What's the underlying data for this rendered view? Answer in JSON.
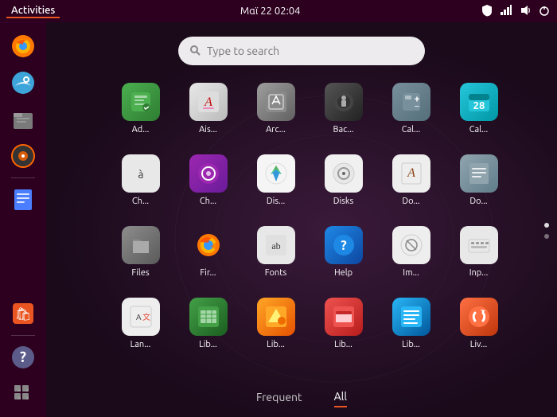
{
  "topbar": {
    "activities": "Activities",
    "datetime": "Μαϊ 22  02:04",
    "icons": [
      "shield",
      "network",
      "volume",
      "power"
    ]
  },
  "search": {
    "placeholder": "Type to search"
  },
  "apps": [
    {
      "label": "Ad...",
      "icon": "🔧",
      "color": "icon-green",
      "text": "Ad"
    },
    {
      "label": "Ais...",
      "icon": "🃏",
      "color": "icon-red",
      "text": "Ai"
    },
    {
      "label": "Arc...",
      "icon": "📦",
      "color": "icon-gray",
      "text": "Ar"
    },
    {
      "label": "Bac...",
      "icon": "💾",
      "color": "icon-dark",
      "text": "Ba"
    },
    {
      "label": "Cal...",
      "icon": "➕",
      "color": "icon-gray",
      "text": "Ca"
    },
    {
      "label": "Cal...",
      "icon": "28",
      "color": "icon-cyan",
      "text": "28"
    },
    {
      "label": "Ch...",
      "icon": "à",
      "color": "icon-white",
      "text": "Ch"
    },
    {
      "label": "Ch...",
      "icon": "◎",
      "color": "icon-purple",
      "text": "Ch"
    },
    {
      "label": "Dis...",
      "icon": "🥧",
      "color": "icon-white",
      "text": "Di"
    },
    {
      "label": "Disks",
      "icon": "💿",
      "color": "icon-white",
      "text": "Di"
    },
    {
      "label": "Do...",
      "icon": "A",
      "color": "icon-white",
      "text": "Do"
    },
    {
      "label": "Do...",
      "icon": "📖",
      "color": "icon-gray",
      "text": "Do"
    },
    {
      "label": "Files",
      "icon": "📁",
      "color": "icon-gray",
      "text": "Fi"
    },
    {
      "label": "Fir...",
      "icon": "🦊",
      "color": "icon-orange",
      "text": "Fi"
    },
    {
      "label": "Fonts",
      "icon": "ab",
      "color": "icon-white",
      "text": "Fo"
    },
    {
      "label": "Help",
      "icon": "?",
      "color": "icon-blue",
      "text": "He"
    },
    {
      "label": "Im...",
      "icon": "🔍",
      "color": "icon-white",
      "text": "Im"
    },
    {
      "label": "Inp...",
      "icon": "⌨",
      "color": "icon-white",
      "text": "In"
    },
    {
      "label": "Lan...",
      "icon": "A文",
      "color": "icon-white",
      "text": "La"
    },
    {
      "label": "Lib...",
      "icon": "📊",
      "color": "icon-deepgreen",
      "text": "Li"
    },
    {
      "label": "Lib...",
      "icon": "📊",
      "color": "icon-amber",
      "text": "Li"
    },
    {
      "label": "Lib...",
      "icon": "📊",
      "color": "icon-red",
      "text": "Li"
    },
    {
      "label": "Lib...",
      "icon": "📄",
      "color": "icon-lightblue",
      "text": "Li"
    },
    {
      "label": "Liv...",
      "icon": "🔄",
      "color": "icon-orange",
      "text": "Li"
    }
  ],
  "tabs": [
    {
      "label": "Frequent",
      "active": false
    },
    {
      "label": "All",
      "active": true
    }
  ],
  "sidebar_apps": [
    {
      "name": "Firefox",
      "emoji": "🦊"
    },
    {
      "name": "Thunderbird",
      "emoji": "🐦"
    },
    {
      "name": "Files",
      "emoji": "📁"
    },
    {
      "name": "Rhythmbox",
      "emoji": "🎵"
    },
    {
      "name": "Writer",
      "emoji": "📄"
    },
    {
      "name": "App Store",
      "emoji": "🛍"
    }
  ],
  "sidebar_bottom": [
    {
      "name": "Help",
      "emoji": "?"
    },
    {
      "name": "App Grid",
      "emoji": "⋮⋮"
    }
  ]
}
